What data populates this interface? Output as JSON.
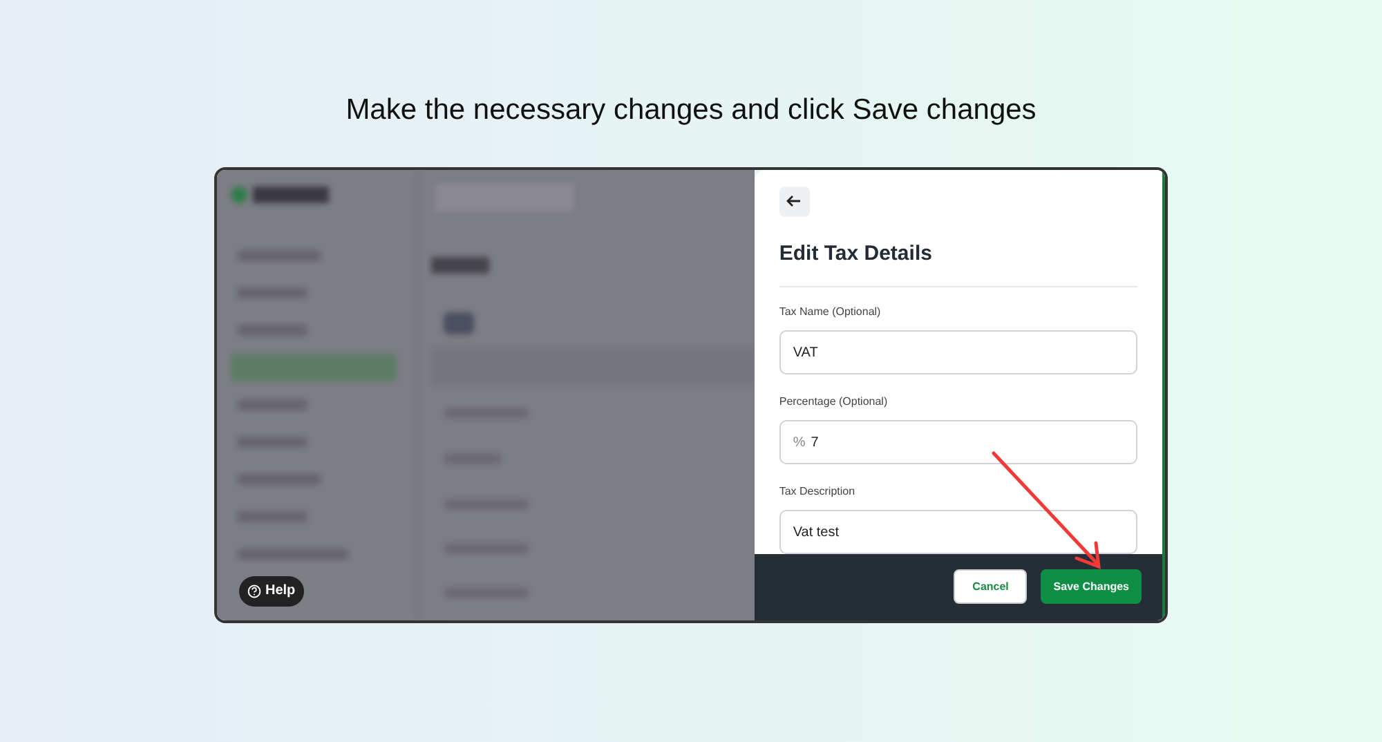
{
  "heading": "Make the necessary changes and click Save changes",
  "background_app": {
    "help_button": "Help"
  },
  "panel": {
    "title": "Edit Tax Details",
    "fields": [
      {
        "label": "Tax Name (Optional)",
        "value": "VAT"
      },
      {
        "label": "Percentage (Optional)",
        "prefix": "%",
        "value": "7"
      },
      {
        "label": "Tax Description",
        "value": "Vat test"
      }
    ],
    "buttons": [
      {
        "label": "Cancel",
        "kind": "secondary"
      },
      {
        "label": "Save Changes",
        "kind": "primary"
      }
    ]
  }
}
